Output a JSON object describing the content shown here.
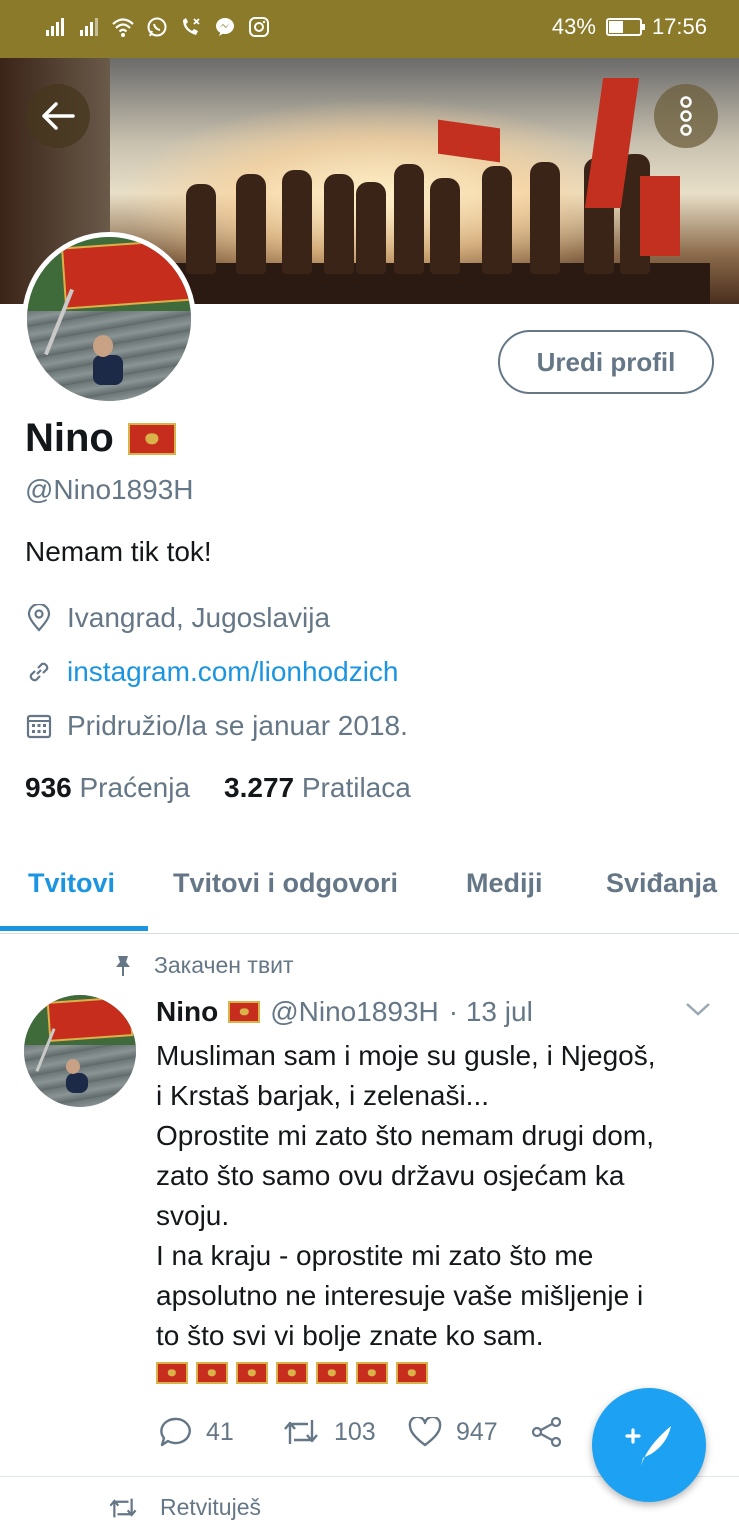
{
  "status_bar": {
    "battery": "43%",
    "battery_level": 0.43,
    "time": "17:56"
  },
  "profile": {
    "edit_button": "Uredi profil",
    "name": "Nino",
    "handle": "@Nino1893H",
    "bio": "Nemam tik tok!",
    "location": "Ivangrad, Jugoslavija",
    "website": "instagram.com/lionhodzich",
    "joined": "Pridružio/la se januar 2018.",
    "following_count": "936",
    "following_label": "Praćenja",
    "followers_count": "3.277",
    "followers_label": "Pratilaca"
  },
  "tabs": [
    {
      "label": "Tvitovi",
      "active": true
    },
    {
      "label": "Tvitovi i odgovori",
      "active": false
    },
    {
      "label": "Mediji",
      "active": false
    },
    {
      "label": "Sviđanja",
      "active": false
    }
  ],
  "tweet": {
    "pinned_label": "Закачен твит",
    "author_name": "Nino",
    "author_handle": "@Nino1893H",
    "date": "· 13 jul",
    "lines": [
      "Musliman sam i moje su gusle, i Njegoš,",
      "i Krstaš barjak, i zelenaši...",
      "Oprostite mi zato što nemam drugi dom,",
      "zato što samo ovu državu osjećam ka",
      "svoju.",
      "I na kraju - oprostite mi zato što me",
      "apsolutno ne interesuje vaše mišljenje i",
      "to što svi vi bolje znate ko sam."
    ],
    "flag_emoji_count": 7,
    "replies": "41",
    "retweets": "103",
    "likes": "947"
  },
  "next_item": {
    "retweeted_label": "Retvituješ"
  },
  "colors": {
    "accent": "#1b95e0",
    "muted": "#657786",
    "status_bar": "#8a7a2a",
    "fab": "#1da1f2",
    "flag_red": "#c62d1d"
  },
  "icons": [
    "signal-icon",
    "wifi-icon",
    "whatsapp-icon",
    "missed-call-icon",
    "messenger-icon",
    "instagram-icon",
    "battery-icon",
    "back-arrow-icon",
    "more-vertical-icon",
    "location-pin-icon",
    "link-icon",
    "calendar-icon",
    "pin-icon",
    "chevron-down-icon",
    "reply-icon",
    "retweet-icon",
    "heart-icon",
    "share-icon",
    "compose-tweet-icon"
  ]
}
